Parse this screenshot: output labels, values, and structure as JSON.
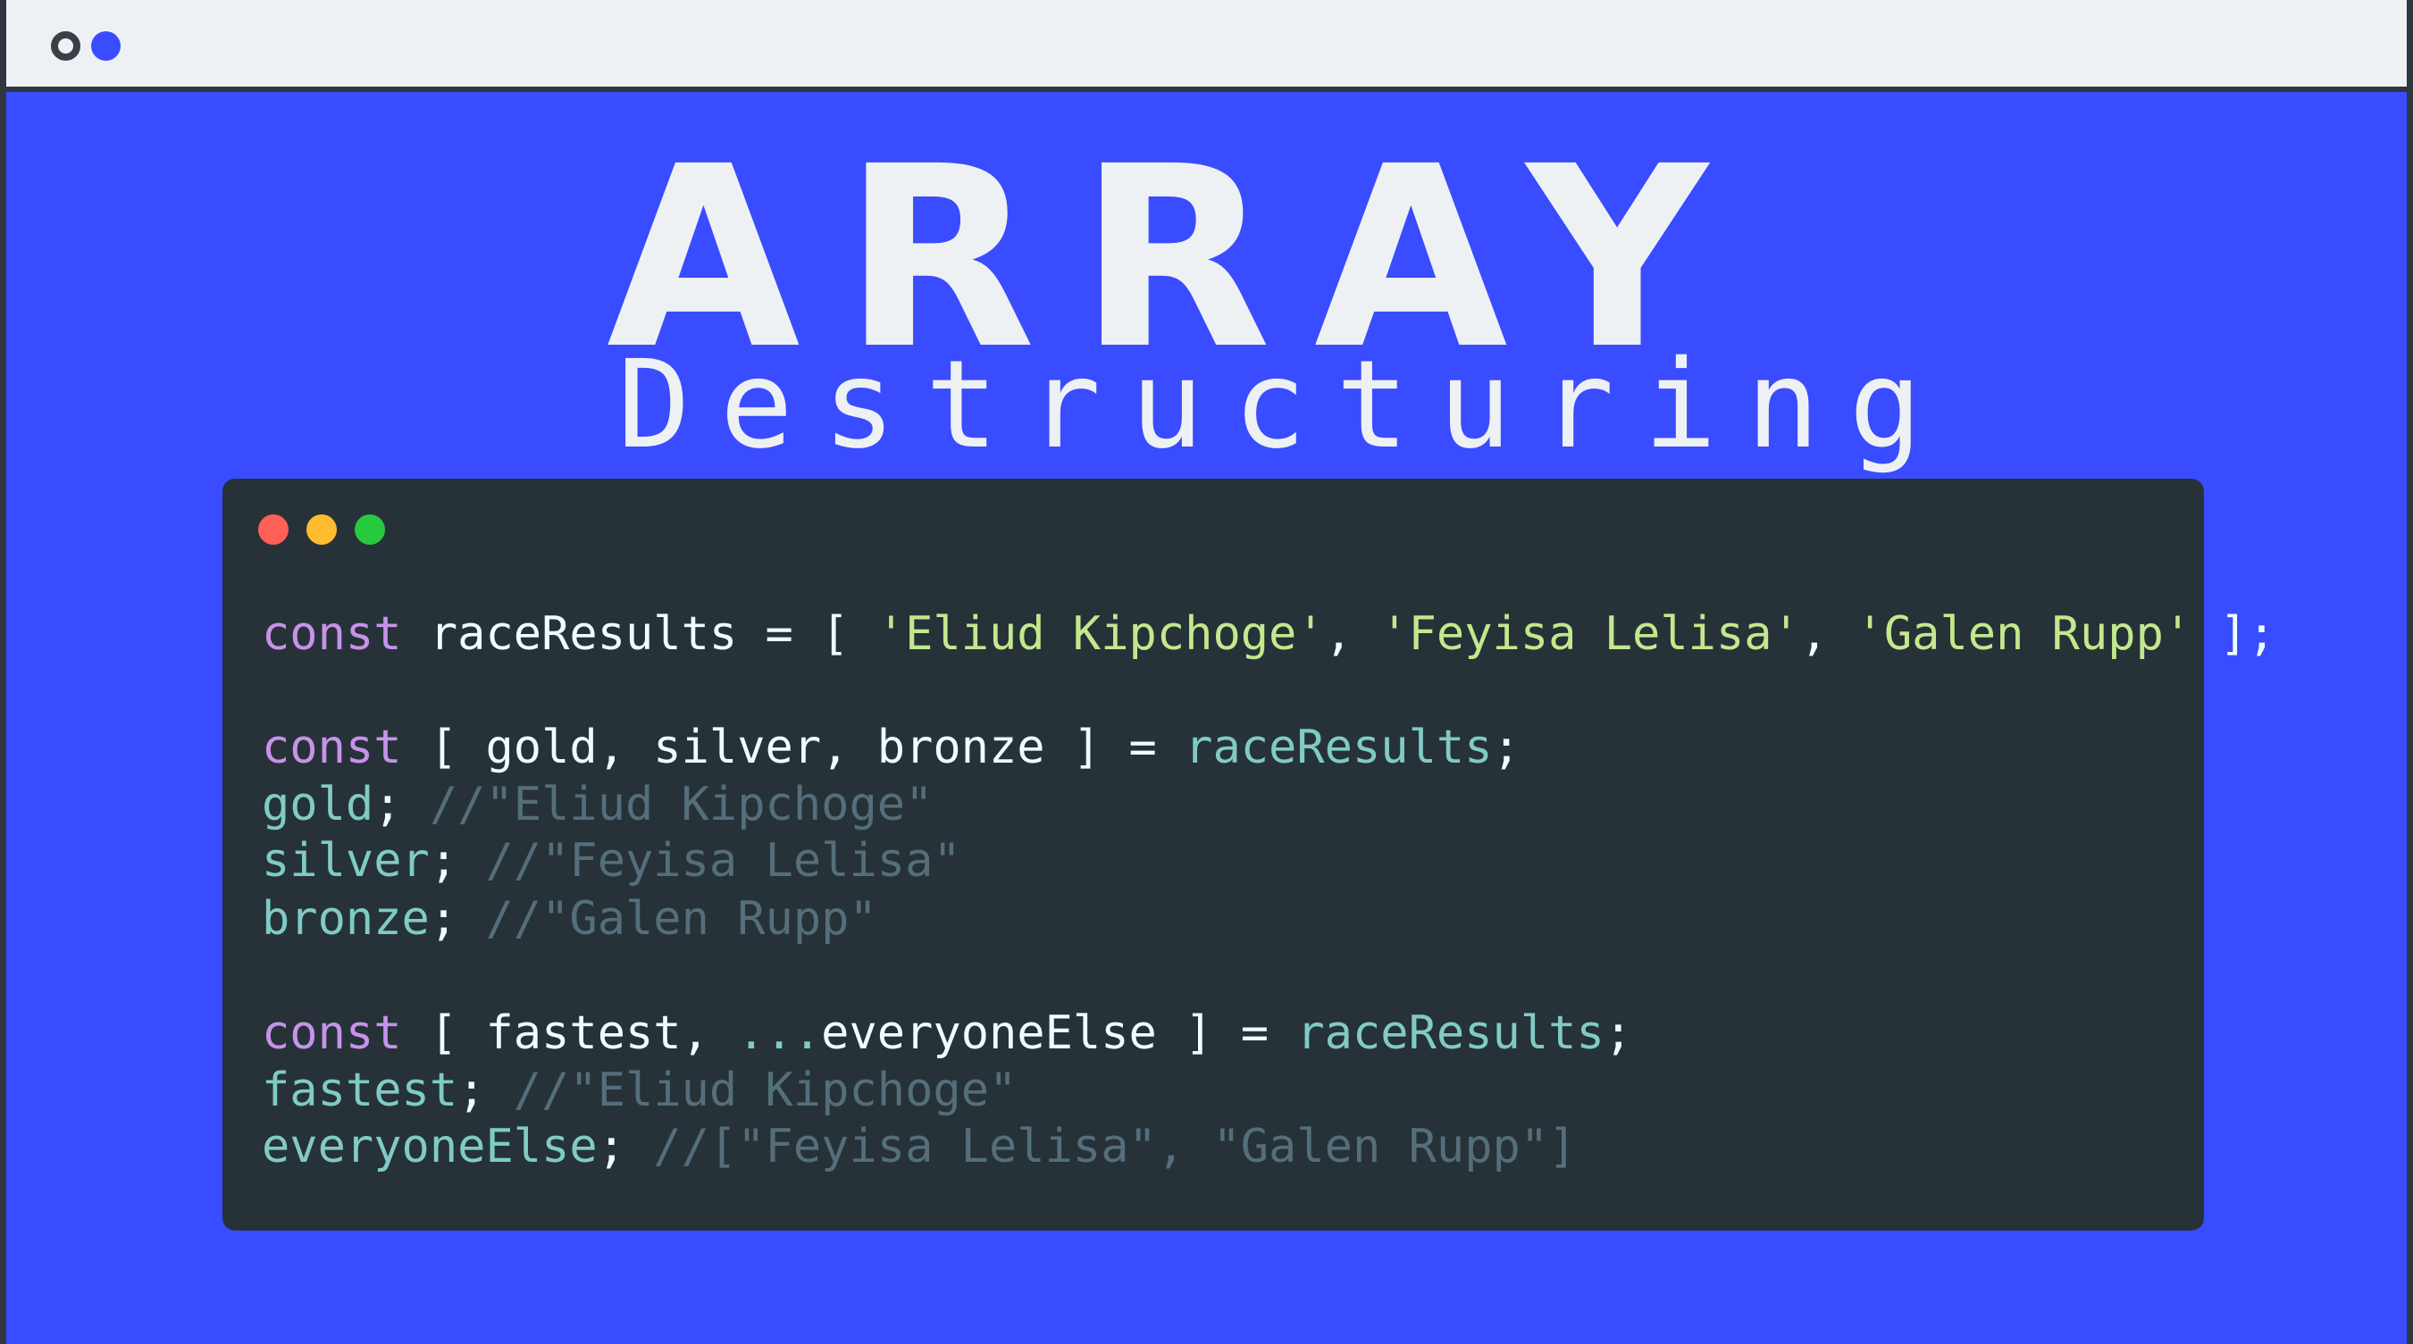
{
  "window": {
    "controls": [
      "outline-dot",
      "filled-dot"
    ]
  },
  "heading": {
    "title": "ARRAY",
    "subtitle": "Destructuring"
  },
  "editor": {
    "controls": [
      "close",
      "minimize",
      "maximize"
    ],
    "lines": [
      {
        "tokens": [
          {
            "text": "const",
            "kind": "kw"
          },
          {
            "text": " raceResults = [ ",
            "kind": "pl"
          },
          {
            "text": "'Eliud Kipchoge'",
            "kind": "str"
          },
          {
            "text": ", ",
            "kind": "pl"
          },
          {
            "text": "'Feyisa Lelisa'",
            "kind": "str"
          },
          {
            "text": ", ",
            "kind": "pl"
          },
          {
            "text": "'Galen Rupp'",
            "kind": "str"
          },
          {
            "text": " ];",
            "kind": "pl"
          }
        ]
      },
      {
        "tokens": [
          {
            "text": "const",
            "kind": "kw"
          },
          {
            "text": " [ gold, silver, bronze ] = ",
            "kind": "pl"
          },
          {
            "text": "raceResults",
            "kind": "id"
          },
          {
            "text": ";",
            "kind": "pl"
          }
        ]
      },
      {
        "tokens": [
          {
            "text": "gold",
            "kind": "id"
          },
          {
            "text": "; ",
            "kind": "pl"
          },
          {
            "text": "//\"Eliud Kipchoge\"",
            "kind": "cm"
          }
        ]
      },
      {
        "tokens": [
          {
            "text": "silver",
            "kind": "id"
          },
          {
            "text": "; ",
            "kind": "pl"
          },
          {
            "text": "//\"Feyisa Lelisa\"",
            "kind": "cm"
          }
        ]
      },
      {
        "tokens": [
          {
            "text": "bronze",
            "kind": "id"
          },
          {
            "text": "; ",
            "kind": "pl"
          },
          {
            "text": "//\"Galen Rupp\"",
            "kind": "cm"
          }
        ]
      },
      {
        "tokens": [
          {
            "text": "const",
            "kind": "kw"
          },
          {
            "text": " [ fastest, ",
            "kind": "pl"
          },
          {
            "text": "...",
            "kind": "id"
          },
          {
            "text": "everyoneElse ] = ",
            "kind": "pl"
          },
          {
            "text": "raceResults",
            "kind": "id"
          },
          {
            "text": ";",
            "kind": "pl"
          }
        ]
      },
      {
        "tokens": [
          {
            "text": "fastest",
            "kind": "id"
          },
          {
            "text": "; ",
            "kind": "pl"
          },
          {
            "text": "//\"Eliud Kipchoge\"",
            "kind": "cm"
          }
        ]
      },
      {
        "tokens": [
          {
            "text": "everyoneElse",
            "kind": "id"
          },
          {
            "text": "; ",
            "kind": "pl"
          },
          {
            "text": "//[\"Feyisa Lelisa\", \"Galen Rupp\"]",
            "kind": "cm"
          }
        ]
      }
    ]
  },
  "colors": {
    "background": "#3a4cff",
    "editor_background": "#263238",
    "keyword": "#c792ea",
    "string": "#c3e88d",
    "identifier": "#80cbc4",
    "comment": "#546e7a",
    "plain": "#eeffff"
  }
}
